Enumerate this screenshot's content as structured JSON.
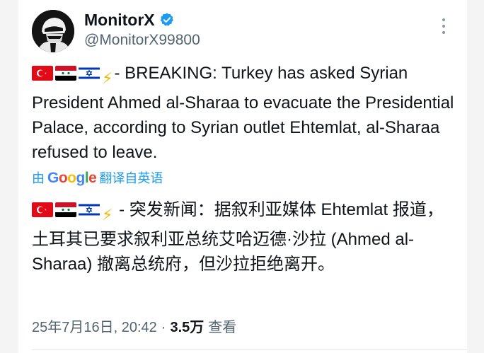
{
  "author": {
    "display_name": "MonitorX",
    "handle": "@MonitorX99800",
    "verified": true,
    "avatar_icon": "masked-figure-avatar"
  },
  "tweet": {
    "flags": [
      "turkey-flag",
      "syria-flag",
      "israel-flag"
    ],
    "bolt_icon": "⚡",
    "english_text": "- BREAKING: Turkey has asked Syrian President Ahmed al-Sharaa to evacuate the Presidential Palace, according to Syrian outlet Ehtemlat, al-Sharaa refused to leave.",
    "translation_prefix": "由",
    "translation_brand": "Google",
    "translation_suffix": "翻译自英语",
    "chinese_text": " - 突发新闻：据叙利亚媒体 Ehtemlat 报道，土耳其已要求叙利亚总统艾哈迈德·沙拉 (Ahmed al-Sharaa) 撤离总统府，但沙拉拒绝离开。"
  },
  "meta": {
    "timestamp": "25年7月16日, 20:42",
    "separator": "·",
    "views_count": "3.5万",
    "views_label": "查看"
  },
  "colors": {
    "link": "#1d9bf0",
    "muted": "#536471",
    "text": "#0f1419",
    "verified": "#1d9bf0"
  }
}
